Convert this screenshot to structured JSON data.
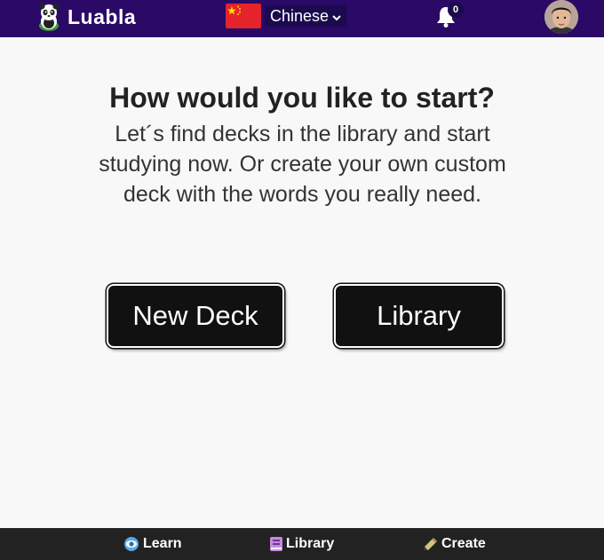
{
  "header": {
    "brand_name": "Luabla",
    "language": {
      "selected": "Chinese",
      "flag": "china-flag-icon",
      "flag_color": "#e4232b"
    },
    "notifications": {
      "count": "0",
      "icon": "bell-icon"
    },
    "avatar": "user-avatar",
    "background_color": "#2a0a66"
  },
  "main": {
    "title": "How would you like to start?",
    "subtitle": "Let´s find decks in the library and start studying now. Or create your own custom deck with the words you really need.",
    "buttons": {
      "new_deck": "New Deck",
      "library": "Library"
    }
  },
  "bottom_nav": {
    "items": [
      {
        "label": "Learn",
        "icon": "eye-icon",
        "icon_color": "#5aa9e6"
      },
      {
        "label": "Library",
        "icon": "book-icon",
        "icon_color": "#c58be0"
      },
      {
        "label": "Create",
        "icon": "pencil-icon",
        "icon_color": "#d8c080"
      }
    ],
    "background_color": "#222222"
  }
}
